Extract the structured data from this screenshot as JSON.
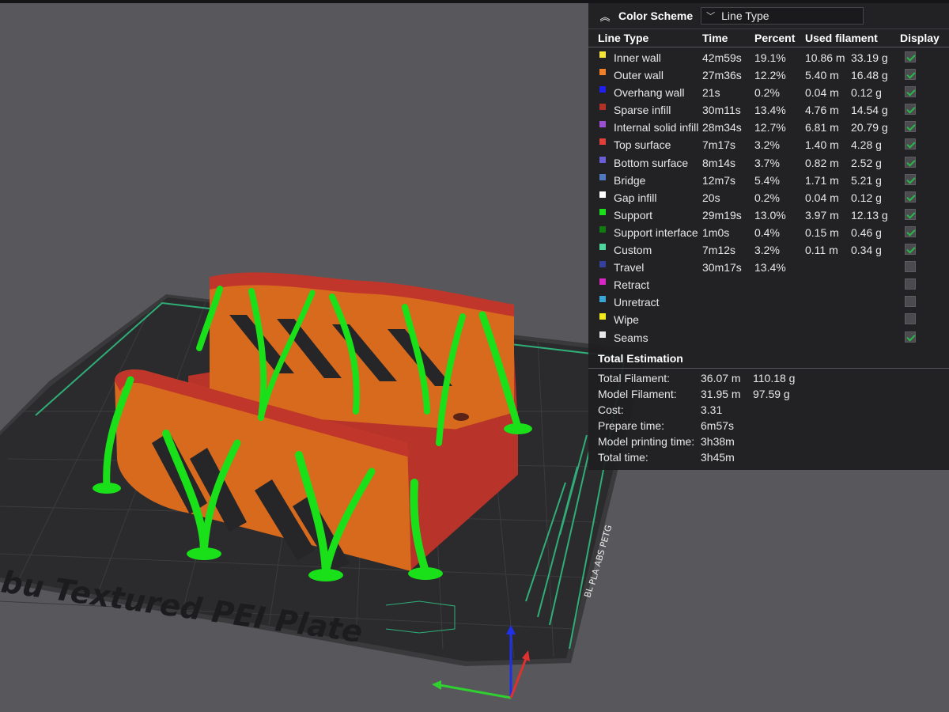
{
  "plate": {
    "label": "bu Textured PEI Plate",
    "side_label": "PLA ABS PETG",
    "side_logo": "BL"
  },
  "colors": {
    "model_orange": "#d86a1e",
    "model_red": "#c0362a",
    "support_green": "#19e019",
    "plate": "#2b2b2d",
    "plate_accent": "#2fae78",
    "panel_bg": "#1e1e20",
    "check_green": "#27b84a"
  },
  "panel": {
    "collapse_icon": "double-chevron-up-icon",
    "title": "Color Scheme",
    "dropdown": {
      "arrow_icon": "chevron-down-icon",
      "value": "Line Type"
    },
    "headers": {
      "line_type": "Line Type",
      "time": "Time",
      "percent": "Percent",
      "used_filament": "Used filament",
      "display": "Display"
    },
    "rows": [
      {
        "name": "Inner wall",
        "color": "#f5e43a",
        "time": "42m59s",
        "percent": "19.1%",
        "length": "10.86 m",
        "weight": "33.19 g",
        "display": true
      },
      {
        "name": "Outer wall",
        "color": "#f08028",
        "time": "27m36s",
        "percent": "12.2%",
        "length": "5.40 m",
        "weight": "16.48 g",
        "display": true
      },
      {
        "name": "Overhang wall",
        "color": "#2020ee",
        "time": "21s",
        "percent": "0.2%",
        "length": "0.04 m",
        "weight": "0.12 g",
        "display": true
      },
      {
        "name": "Sparse infill",
        "color": "#b03228",
        "time": "30m11s",
        "percent": "13.4%",
        "length": "4.76 m",
        "weight": "14.54 g",
        "display": true
      },
      {
        "name": "Internal solid infill",
        "color": "#9b4fd1",
        "time": "28m34s",
        "percent": "12.7%",
        "length": "6.81 m",
        "weight": "20.79 g",
        "display": true
      },
      {
        "name": "Top surface",
        "color": "#e0403a",
        "time": "7m17s",
        "percent": "3.2%",
        "length": "1.40 m",
        "weight": "4.28 g",
        "display": true
      },
      {
        "name": "Bottom surface",
        "color": "#6a5ed6",
        "time": "8m14s",
        "percent": "3.7%",
        "length": "0.82 m",
        "weight": "2.52 g",
        "display": true
      },
      {
        "name": "Bridge",
        "color": "#4f78bf",
        "time": "12m7s",
        "percent": "5.4%",
        "length": "1.71 m",
        "weight": "5.21 g",
        "display": true
      },
      {
        "name": "Gap infill",
        "color": "#ffffff",
        "time": "20s",
        "percent": "0.2%",
        "length": "0.04 m",
        "weight": "0.12 g",
        "display": true
      },
      {
        "name": "Support",
        "color": "#19e019",
        "time": "29m19s",
        "percent": "13.0%",
        "length": "3.97 m",
        "weight": "12.13 g",
        "display": true
      },
      {
        "name": "Support interface",
        "color": "#127a12",
        "time": "1m0s",
        "percent": "0.4%",
        "length": "0.15 m",
        "weight": "0.46 g",
        "display": true
      },
      {
        "name": "Custom",
        "color": "#4fd69a",
        "time": "7m12s",
        "percent": "3.2%",
        "length": "0.11 m",
        "weight": "0.34 g",
        "display": true
      },
      {
        "name": "Travel",
        "color": "#35409e",
        "time": "30m17s",
        "percent": "13.4%",
        "length": "",
        "weight": "",
        "display": false
      },
      {
        "name": "Retract",
        "color": "#d826c4",
        "time": "",
        "percent": "",
        "length": "",
        "weight": "",
        "display": false
      },
      {
        "name": "Unretract",
        "color": "#3aa6d8",
        "time": "",
        "percent": "",
        "length": "",
        "weight": "",
        "display": false
      },
      {
        "name": "Wipe",
        "color": "#f2ea1a",
        "time": "",
        "percent": "",
        "length": "",
        "weight": "",
        "display": false
      },
      {
        "name": "Seams",
        "color": "#e8e8e8",
        "time": "",
        "percent": "",
        "length": "",
        "weight": "",
        "display": true
      }
    ],
    "total": {
      "title": "Total Estimation",
      "rows": [
        {
          "label": "Total Filament:",
          "value": "36.07 m",
          "value2": "110.18 g"
        },
        {
          "label": "Model Filament:",
          "value": "31.95 m",
          "value2": "97.59 g"
        },
        {
          "label": "Cost:",
          "value": "3.31",
          "value2": ""
        },
        {
          "label": "Prepare time:",
          "value": "6m57s",
          "value2": ""
        },
        {
          "label": "Model printing time:",
          "value": "3h38m",
          "value2": ""
        },
        {
          "label": "Total time:",
          "value": "3h45m",
          "value2": ""
        }
      ]
    }
  }
}
